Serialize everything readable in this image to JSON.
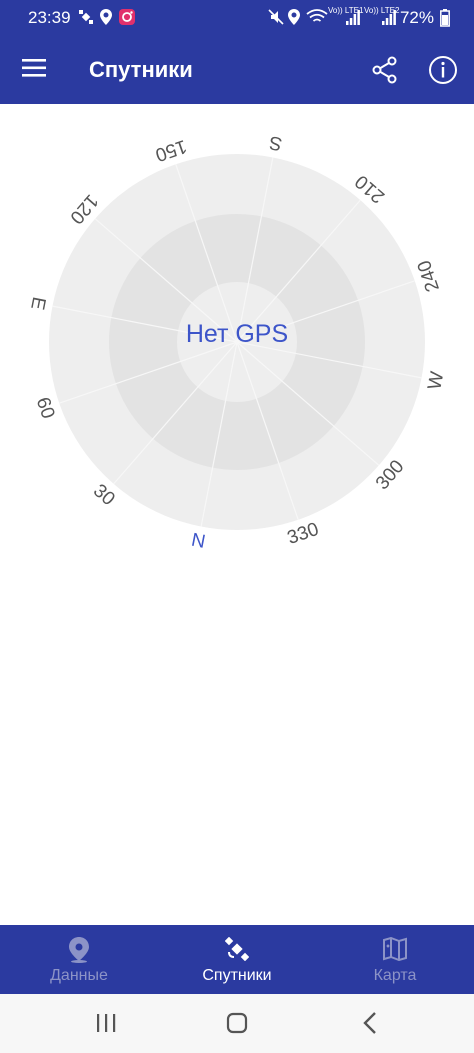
{
  "status_bar": {
    "time": "23:39",
    "battery": "72%",
    "signal_labels": [
      "Vo)) LTE1",
      "Vo)) LTE2"
    ]
  },
  "app_bar": {
    "title": "Спутники",
    "icons": [
      "menu-icon",
      "share-icon",
      "info-icon"
    ]
  },
  "compass": {
    "center_text": "Нет GPS",
    "labels": {
      "n": "N",
      "d30": "30",
      "d60": "60",
      "e": "E",
      "d120": "120",
      "d150": "150",
      "s": "S",
      "d210": "210",
      "d240": "240",
      "w": "W",
      "d300": "300",
      "d330": "330"
    },
    "colors": {
      "north": "#3d55c9",
      "labels": "#555555",
      "center_text": "#3d55c9",
      "ring_outer": "#eeeeee",
      "ring_middle": "#e3e3e3",
      "ring_inner": "#eeeeee"
    }
  },
  "bottom_nav": {
    "items": [
      {
        "label": "Данные",
        "icon": "location-pin-icon",
        "active": false
      },
      {
        "label": "Спутники",
        "icon": "satellite-icon",
        "active": true
      },
      {
        "label": "Карта",
        "icon": "map-icon",
        "active": false
      }
    ]
  },
  "system_nav": {
    "buttons": [
      "recent-apps-icon",
      "home-icon",
      "back-icon"
    ]
  }
}
